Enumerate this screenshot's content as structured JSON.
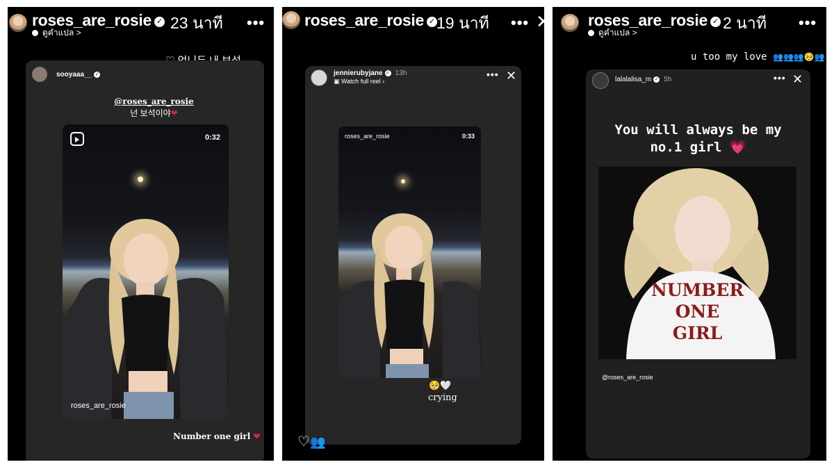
{
  "colors": {
    "panel_bg": "#000000",
    "card_bg": "#262626",
    "heart": "#e0203a",
    "pink_heart": "#e84a9b",
    "shirt_text": "#8c1a1a"
  },
  "panels": [
    {
      "username": "roses_are_rosie",
      "time": "23 นาที",
      "translate": "ดูคำแปล >",
      "more": "•••",
      "reply": "♡ 언니두 내 보석",
      "card": {
        "user": "sooyaaa__",
        "mention": "@roses_are_rosie",
        "caption": "넌 보석이야",
        "video_duration": "0:32",
        "video_label": "roses_are_rosie",
        "footer": "Number one girl"
      }
    },
    {
      "username": "roses_are_rosie",
      "time": "19 นาที",
      "more": "•••",
      "close": "✕",
      "card": {
        "user": "jennierubyjane",
        "time": "13h",
        "sub": "Watch full reel ›",
        "more": "•••",
        "close": "✕",
        "video_label": "roses_are_rosie",
        "video_duration": "0:33",
        "emoji": "🥺🤍",
        "text": "crying"
      },
      "reply": "♡"
    },
    {
      "username": "roses_are_rosie",
      "time": "2 นาที",
      "translate": "ดูคำแปล >",
      "more": "•••",
      "reply": "u too my love",
      "card": {
        "user": "lalalalisa_m",
        "time": "5h",
        "more": "•••",
        "close": "✕",
        "heading_line1": "You will always be my",
        "heading_line2": "no.1 girl",
        "shirt_line1": "NUMBER",
        "shirt_line2": "ONE",
        "shirt_line3": "GIRL",
        "mention": "@roses_are_rosie"
      }
    }
  ]
}
